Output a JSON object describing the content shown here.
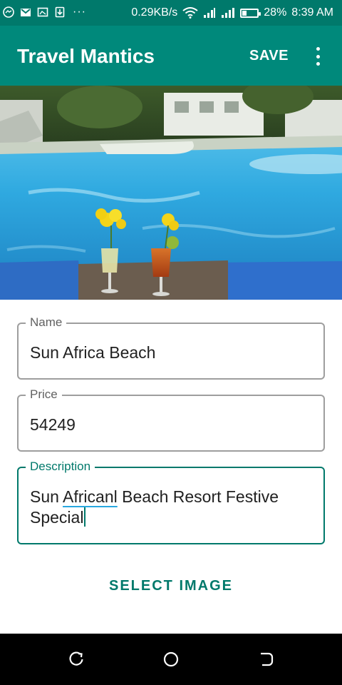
{
  "status_bar": {
    "net_speed": "0.29KB/s",
    "battery": "28%",
    "time": "8:39 AM",
    "more": "···"
  },
  "app_bar": {
    "title": "Travel Mantics",
    "save_label": "SAVE"
  },
  "form": {
    "name": {
      "label": "Name",
      "value": "Sun Africa Beach"
    },
    "price": {
      "label": "Price",
      "value": "54249"
    },
    "description": {
      "label": "Description",
      "value_before": "Sun ",
      "value_misspelled": "Africanl",
      "value_after": " Beach Resort Festive",
      "value_line2": "Special"
    }
  },
  "select_image_label": "SELECT IMAGE",
  "colors": {
    "primary": "#00897b",
    "primary_dark": "#00796b",
    "accent": "#00796b"
  },
  "icons": {
    "status_left": [
      "messenger-icon",
      "gmail-icon",
      "screenshot-icon",
      "download-icon"
    ],
    "status_right": [
      "wifi-icon",
      "signal-icon",
      "signal-icon",
      "battery-icon"
    ],
    "nav": [
      "recent-apps-icon",
      "home-icon",
      "back-icon"
    ]
  }
}
